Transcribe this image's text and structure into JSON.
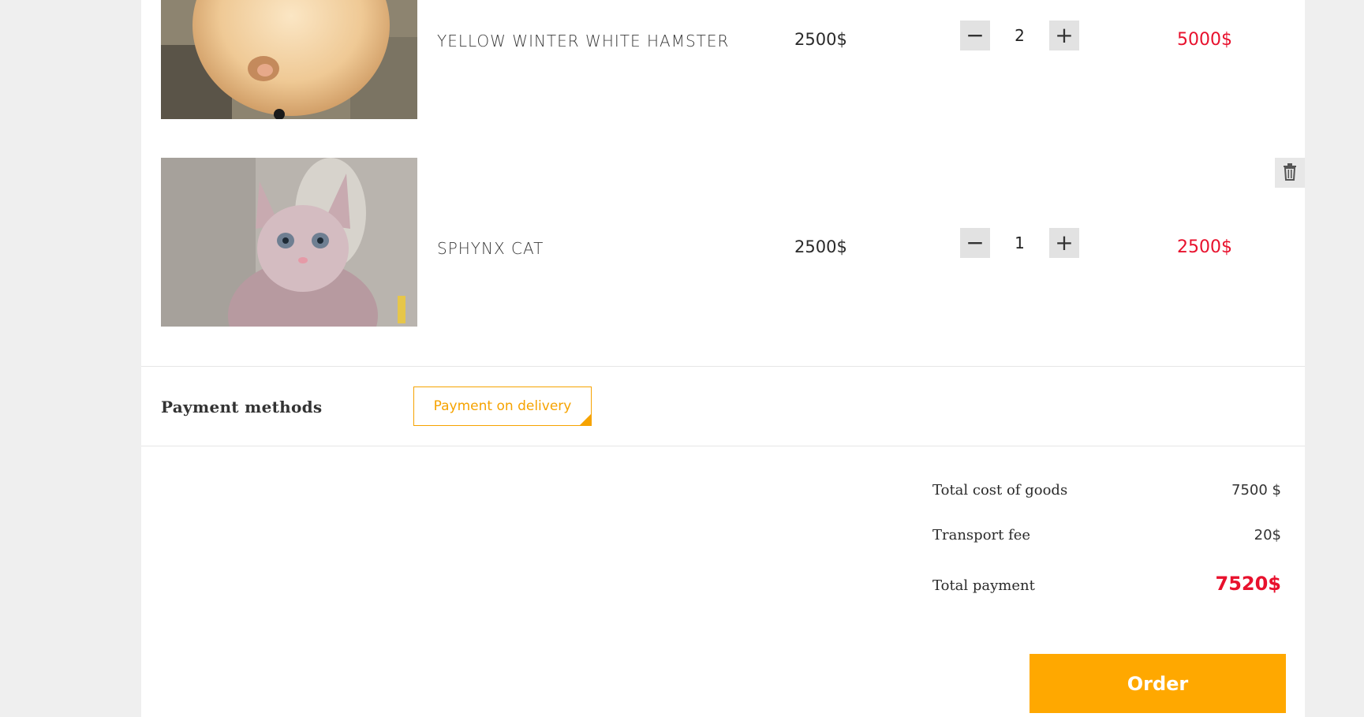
{
  "cart": {
    "items": [
      {
        "name": "YELLOW WINTER WHITE HAMSTER",
        "price": "2500$",
        "quantity": "2",
        "subtotal": "5000$",
        "image_icon": "hamster-photo"
      },
      {
        "name": "SPHYNX CAT",
        "price": "2500$",
        "quantity": "1",
        "subtotal": "2500$",
        "image_icon": "sphynx-cat-photo"
      }
    ],
    "minus_symbol": "−",
    "plus_symbol": "+"
  },
  "payment": {
    "label": "Payment methods",
    "option": "Payment on delivery"
  },
  "summary": {
    "goods_label": "Total cost of goods",
    "goods_value": "7500 $",
    "transport_label": "Transport fee",
    "transport_value": "20$",
    "total_label": "Total payment",
    "total_value": "7520$"
  },
  "order_button": "Order",
  "colors": {
    "accent": "#ffa800",
    "price_red": "#e8112d",
    "page_bg": "#efefef"
  }
}
